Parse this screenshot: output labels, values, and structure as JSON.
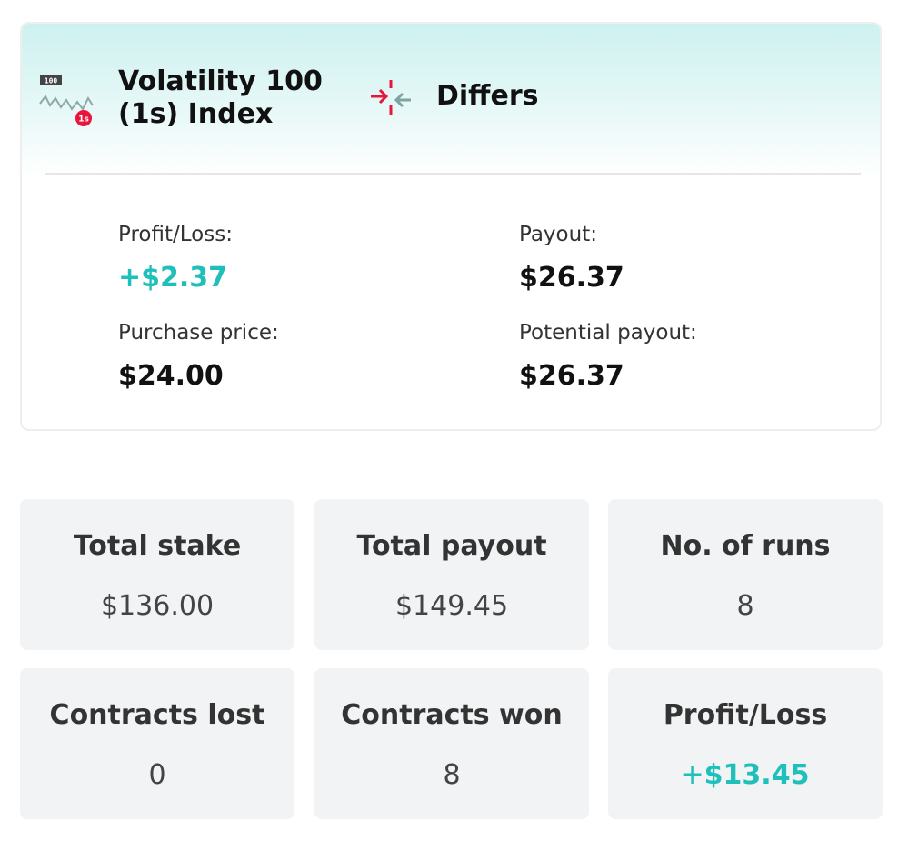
{
  "contract": {
    "market_name": "Volatility 100 (1s) Index",
    "market_icon": "volatility-index-icon",
    "trade_type": "Differs",
    "trade_type_icon": "differs-arrows-icon",
    "profit_loss_label": "Profit/Loss:",
    "profit_loss_value": "+$2.37",
    "payout_label": "Payout:",
    "payout_value": "$26.37",
    "purchase_price_label": "Purchase price:",
    "purchase_price_value": "$24.00",
    "potential_payout_label": "Potential payout:",
    "potential_payout_value": "$26.37"
  },
  "summary": [
    {
      "label": "Total stake",
      "value": "$136.00"
    },
    {
      "label": "Total payout",
      "value": "$149.45"
    },
    {
      "label": "No. of runs",
      "value": "8"
    },
    {
      "label": "Contracts lost",
      "value": "0"
    },
    {
      "label": "Contracts won",
      "value": "8"
    },
    {
      "label": "Profit/Loss",
      "value": "+$13.45"
    }
  ],
  "colors": {
    "profit": "#1fc0bb",
    "loss_accent": "#e8163c",
    "header_bg": "#cdf1ef",
    "stat_bg": "#f2f3f4"
  }
}
